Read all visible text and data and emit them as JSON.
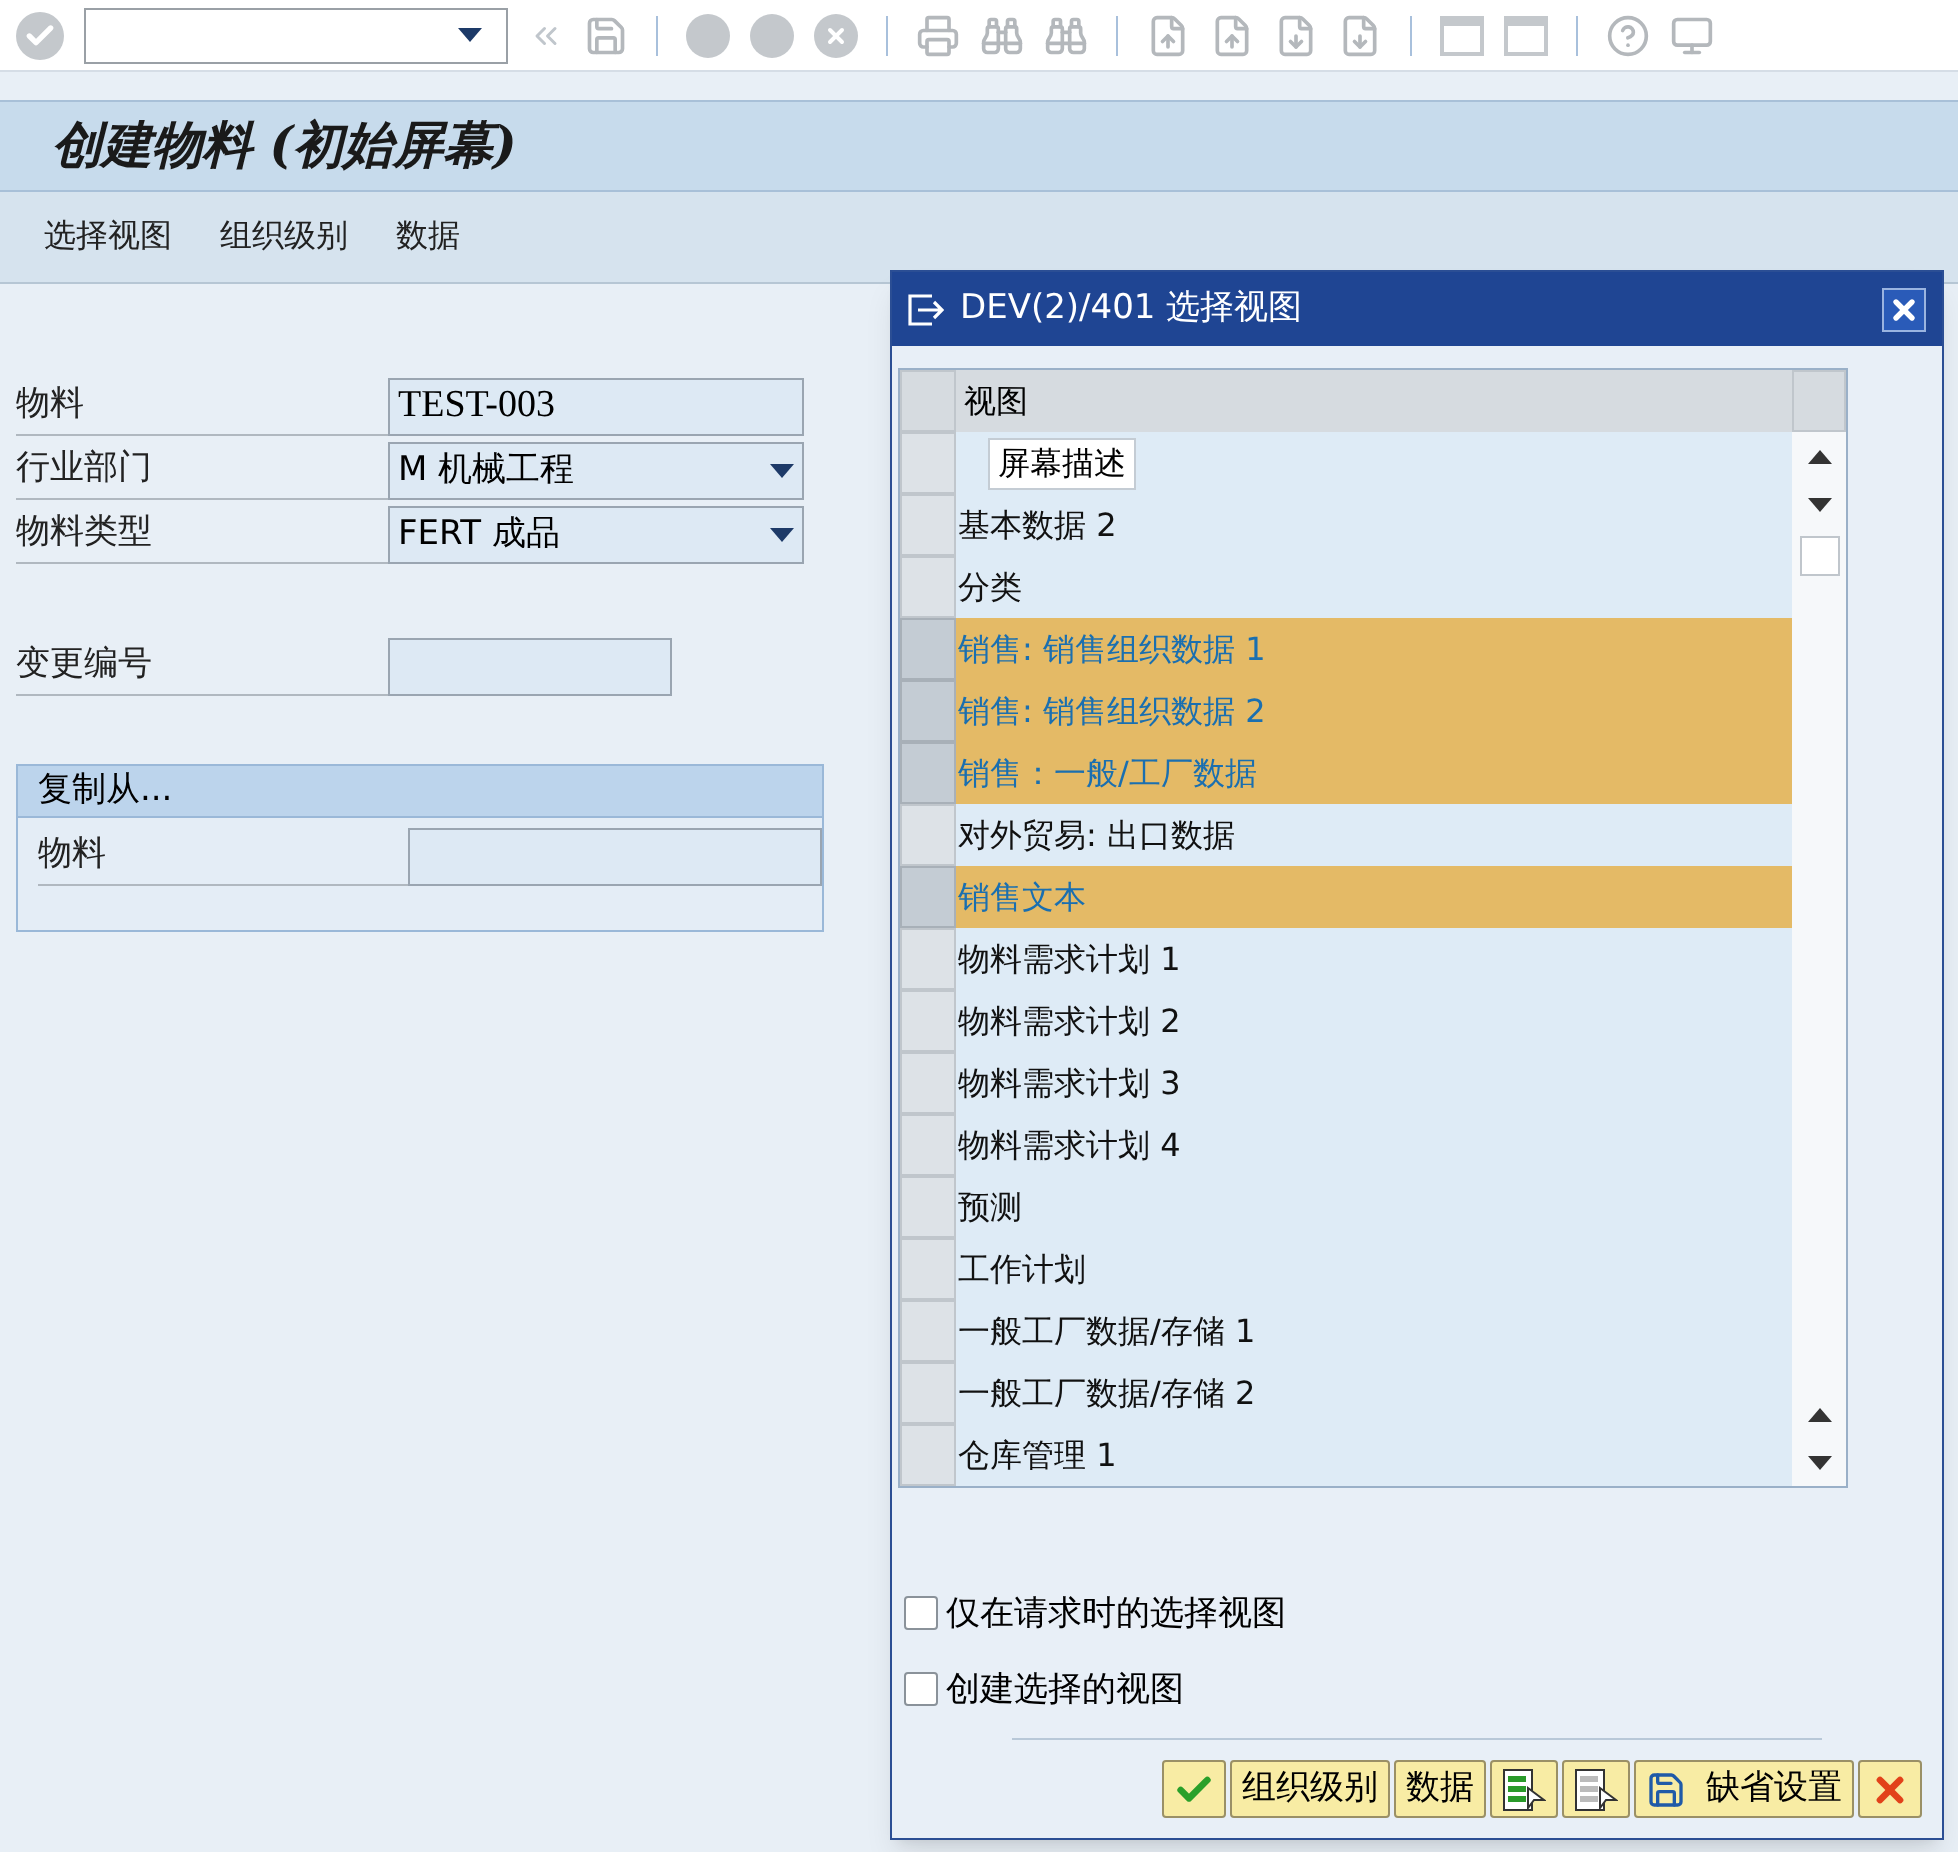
{
  "screen_title": "创建物料 (初始屏幕)",
  "menu": [
    "选择视图",
    "组织级别",
    "数据"
  ],
  "fields": [
    {
      "label": "物料",
      "kind": "text",
      "value": "TEST-003"
    },
    {
      "label": "行业部门",
      "kind": "dropdown",
      "value": "M 机械工程"
    },
    {
      "label": "物料类型",
      "kind": "dropdown",
      "value": "FERT 成品"
    },
    {
      "label": "变更编号",
      "kind": "short"
    }
  ],
  "copy_from": {
    "title": "复制从...",
    "fields": [
      {
        "label": "物料",
        "kind": "text"
      }
    ]
  },
  "dialog": {
    "title": "DEV(2)/401 选择视图",
    "column": "视图",
    "tooltip": "屏幕描述",
    "rows": [
      {
        "selected": false
      },
      {
        "label": "基本数据 2",
        "selected": false
      },
      {
        "label": "分类",
        "selected": false
      },
      {
        "label": "销售: 销售组织数据 1",
        "selected": true
      },
      {
        "label": "销售: 销售组织数据 2",
        "selected": true
      },
      {
        "label": "销售：一般/工厂数据",
        "selected": true
      },
      {
        "label": "对外贸易: 出口数据",
        "selected": false
      },
      {
        "label": "销售文本",
        "selected": true
      },
      {
        "label": "物料需求计划 1",
        "selected": false
      },
      {
        "label": "物料需求计划 2",
        "selected": false
      },
      {
        "label": "物料需求计划 3",
        "selected": false
      },
      {
        "label": "物料需求计划 4",
        "selected": false
      },
      {
        "label": "预测",
        "selected": false
      },
      {
        "label": "工作计划",
        "selected": false
      },
      {
        "label": "一般工厂数据/存储 1",
        "selected": false
      },
      {
        "label": "一般工厂数据/存储 2",
        "selected": false
      },
      {
        "label": "仓库管理 1",
        "selected": false
      }
    ],
    "options": [
      {
        "label": "仅在请求时的选择视图",
        "checked": false
      },
      {
        "label": "创建选择的视图",
        "checked": false
      }
    ],
    "buttons": [
      {
        "kind": "confirm"
      },
      {
        "kind": "text",
        "label": "组织级别"
      },
      {
        "kind": "text",
        "label": "数据"
      },
      {
        "kind": "select-all"
      },
      {
        "kind": "deselect-all"
      },
      {
        "kind": "save",
        "label": "缺省设置"
      },
      {
        "kind": "cancel"
      }
    ]
  }
}
